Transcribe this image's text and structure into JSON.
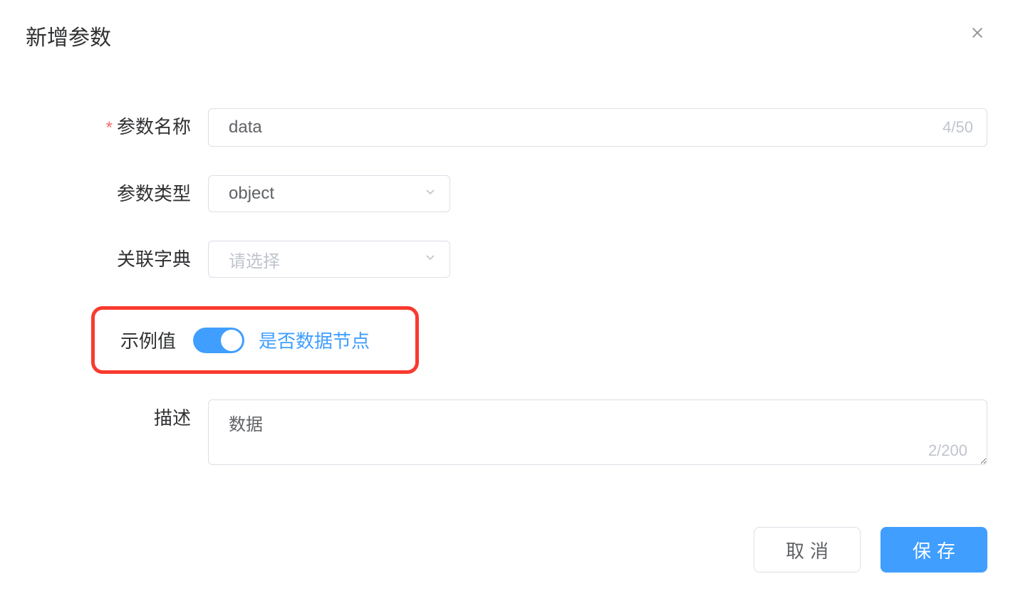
{
  "modal": {
    "title": "新增参数"
  },
  "form": {
    "param_name": {
      "label": "参数名称",
      "value": "data",
      "counter": "4/50"
    },
    "param_type": {
      "label": "参数类型",
      "value": "object"
    },
    "dictionary": {
      "label": "关联字典",
      "placeholder": "请选择"
    },
    "example": {
      "label": "示例值",
      "toggle_label": "是否数据节点"
    },
    "description": {
      "label": "描述",
      "value": "数据",
      "counter": "2/200"
    }
  },
  "footer": {
    "cancel": "取消",
    "save": "保存"
  }
}
